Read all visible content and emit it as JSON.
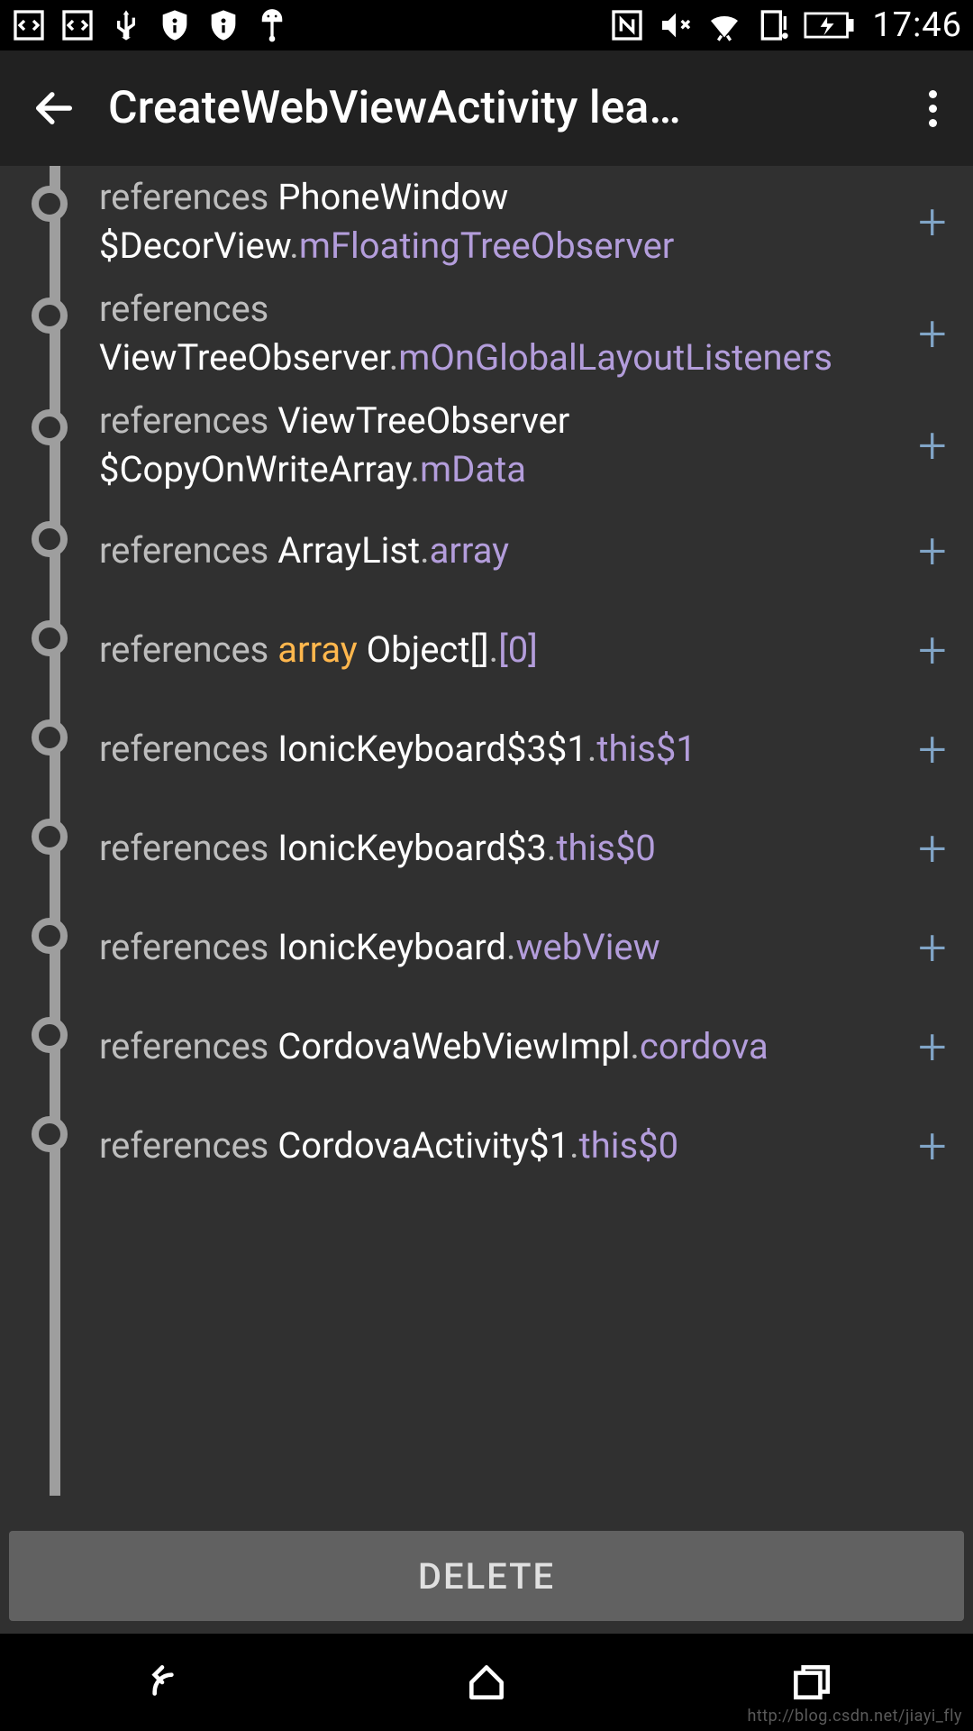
{
  "status": {
    "time": "17:46"
  },
  "appbar": {
    "title": "CreateWebViewActivity lea…"
  },
  "rows": [
    {
      "refs": "references ",
      "cls1": "PhoneWindow $DecorView",
      "sep1": ".",
      "fld1": "mFloatingTreeObserver"
    },
    {
      "refs": "references ",
      "cls1": "ViewTreeObserver",
      "sep1": ".",
      "fld1": "mOnGlobalLayoutListeners"
    },
    {
      "refs": "references ",
      "cls1": "ViewTreeObserver $CopyOnWriteArray",
      "sep1": ".",
      "fld1": "mData"
    },
    {
      "refs": "references ",
      "cls1": "ArrayList",
      "sep1": ".",
      "fld1": "array"
    },
    {
      "refs": "references ",
      "kw": "array",
      "cls1": " Object[]",
      "sep1": ".",
      "fld1": "[0]"
    },
    {
      "refs": "references ",
      "cls1": "IonicKeyboard$3$1",
      "sep1": ".",
      "fld1": "this$1"
    },
    {
      "refs": "references ",
      "cls1": "IonicKeyboard$3",
      "sep1": ".",
      "fld1": "this$0"
    },
    {
      "refs": "references ",
      "cls1": "IonicKeyboard",
      "sep1": ".",
      "fld1": "webView"
    },
    {
      "refs": "references ",
      "cls1": "CordovaWebViewImpl",
      "sep1": ".",
      "fld1": "cordova"
    },
    {
      "refs": "references ",
      "cls1": "CordovaActivity$1",
      "sep1": ".",
      "fld1": "this$0"
    }
  ],
  "delete_label": "DELETE",
  "plus": "+",
  "watermark": "http://blog.csdn.net/jiayi_fly"
}
